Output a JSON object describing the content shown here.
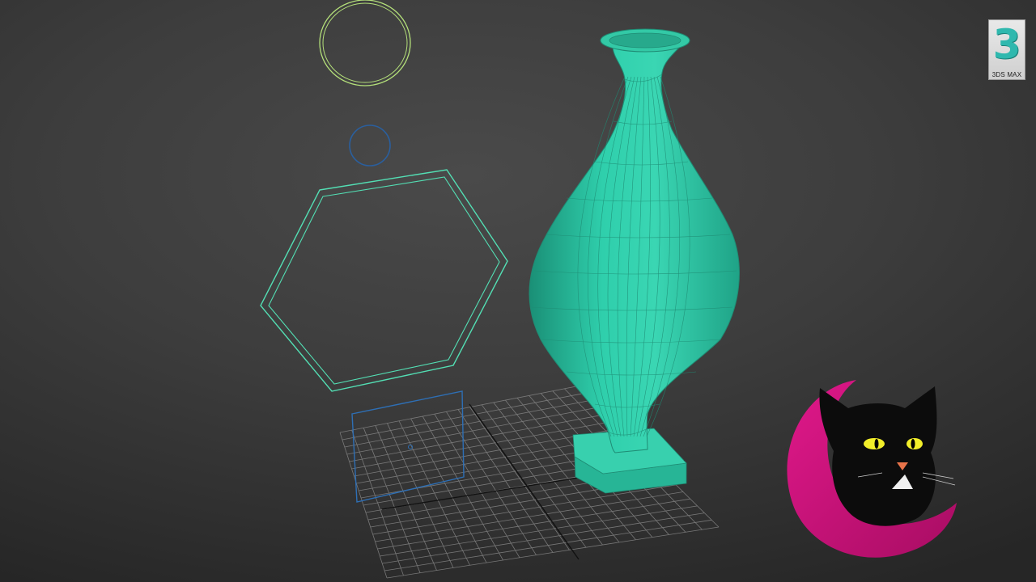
{
  "app": {
    "logo_digit": "3",
    "logo_caption": "3DS MAX",
    "logo_color": "#2fb8ae"
  },
  "scene": {
    "background": "#3d3d3d",
    "vase_color": "#2fbf9f",
    "wire_color": "#1f8c74",
    "shape_colors": {
      "large-circle": "#b4e07a",
      "small-circle": "#2a5f9e",
      "hexagon": "#53dfb4",
      "plane": "#2e6fb5",
      "grid": "#8a8a8a",
      "grid-axis": "#111111"
    },
    "channel_icon": {
      "name": "black-cat-moon-icon",
      "moon_color": "#d4157f",
      "eye_color": "#f2ee2a"
    }
  }
}
